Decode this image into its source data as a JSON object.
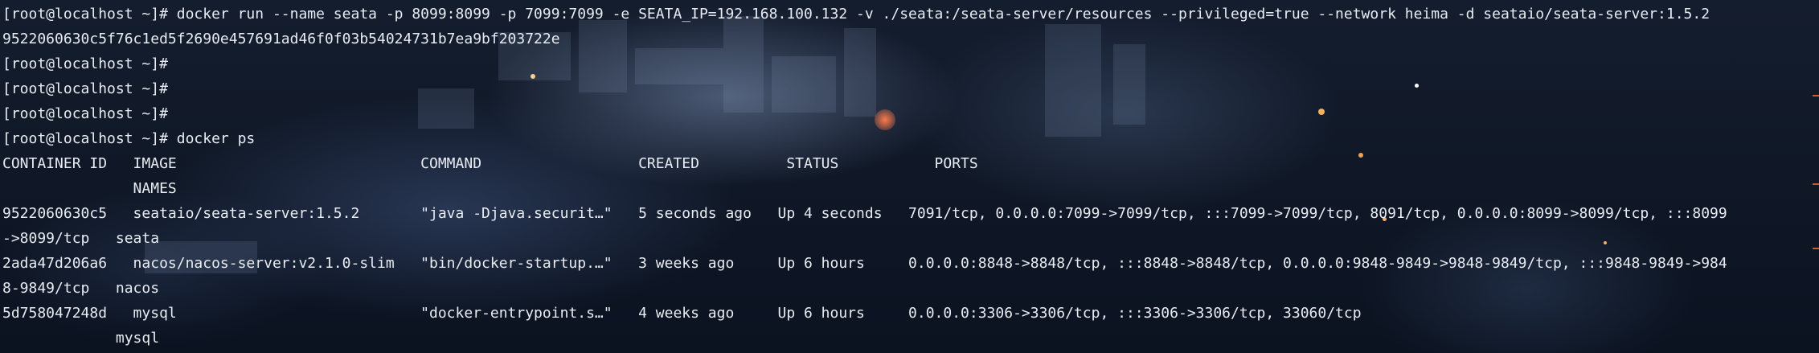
{
  "terminal": {
    "lines": [
      "[root@localhost ~]# docker run --name seata -p 8099:8099 -p 7099:7099 -e SEATA_IP=192.168.100.132 -v ./seata:/seata-server/resources --privileged=true --network heima -d seataio/seata-server:1.5.2",
      "9522060630c5f76c1ed5f2690e457691ad46f0f03b54024731b7ea9bf203722e",
      "[root@localhost ~]#",
      "[root@localhost ~]#",
      "[root@localhost ~]#",
      "[root@localhost ~]# docker ps",
      "CONTAINER ID   IMAGE                            COMMAND                  CREATED          STATUS           PORTS",
      "               NAMES",
      "9522060630c5   seataio/seata-server:1.5.2       \"java -Djava.securit…\"   5 seconds ago   Up 4 seconds   7091/tcp, 0.0.0.0:7099->7099/tcp, :::7099->7099/tcp, 8091/tcp, 0.0.0.0:8099->8099/tcp, :::8099",
      "->8099/tcp   seata",
      "2ada47d206a6   nacos/nacos-server:v2.1.0-slim   \"bin/docker-startup.…\"   3 weeks ago     Up 6 hours     0.0.0.0:8848->8848/tcp, :::8848->8848/tcp, 0.0.0.0:9848-9849->9848-9849/tcp, :::9848-9849->984",
      "8-9849/tcp   nacos",
      "5d758047248d   mysql                            \"docker-entrypoint.s…\"   4 weeks ago     Up 6 hours     0.0.0.0:3306->3306/tcp, :::3306->3306/tcp, 33060/tcp",
      "             mysql"
    ]
  },
  "theme": {
    "text_color": "#e8ecf2",
    "background_color": "#101827",
    "accent_color": "#d05a2a"
  }
}
